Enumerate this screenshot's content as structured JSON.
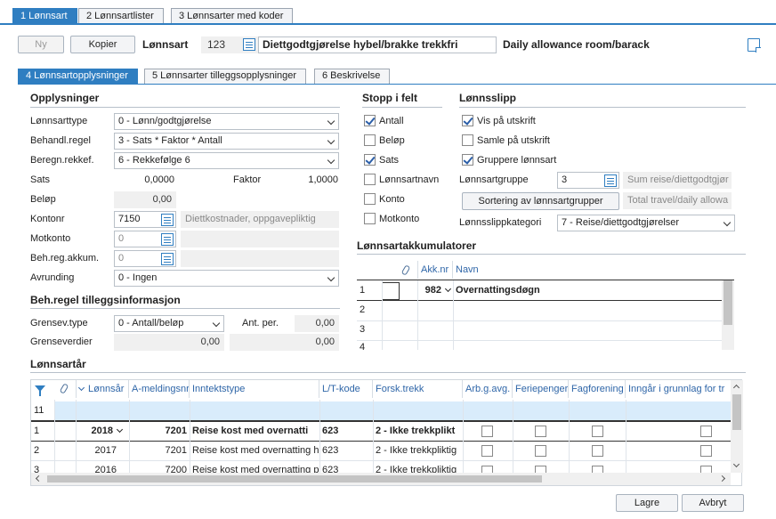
{
  "tabs": [
    {
      "label": "1 Lønnsart",
      "active": true
    },
    {
      "label": "2 Lønnsartlister",
      "active": false
    },
    {
      "label": "3 Lønnsarter med koder",
      "active": false
    }
  ],
  "toolbar": {
    "new_label": "Ny",
    "copy_label": "Kopier",
    "field_label": "Lønnsart",
    "wage_code": "123",
    "description": "Diettgodtgjørelse hybel/brakke trekkfri",
    "english": "Daily allowance room/barack"
  },
  "subtabs": [
    {
      "label": "4 Lønnsartopplysninger",
      "active": true
    },
    {
      "label": "5 Lønnsarter tilleggsopplysninger",
      "active": false
    },
    {
      "label": "6 Beskrivelse",
      "active": false
    }
  ],
  "opplysninger": {
    "title": "Opplysninger",
    "lonnsarttype_label": "Lønnsarttype",
    "lonnsarttype_value": "0 - Lønn/godtgjørelse",
    "behandl_label": "Behandl.regel",
    "behandl_value": "3 - Sats * Faktor * Antall",
    "beregn_label": "Beregn.rekkef.",
    "beregn_value": "6 - Rekkefølge 6",
    "sats_label": "Sats",
    "sats_value": "0,0000",
    "faktor_label": "Faktor",
    "faktor_value": "1,0000",
    "belop_label": "Beløp",
    "belop_value": "0,00",
    "kontonr_label": "Kontonr",
    "kontonr_value": "7150",
    "kontonr_desc": "Diettkostnader, oppgavepliktig",
    "motkonto_label": "Motkonto",
    "motkonto_value": "0",
    "behreg_label": "Beh.reg.akkum.",
    "behreg_value": "0",
    "avrunding_label": "Avrunding",
    "avrunding_value": "0 - Ingen"
  },
  "tillegg": {
    "title": "Beh.regel tilleggsinformasjon",
    "grensev_label": "Grensev.type",
    "grensev_value": "0 - Antall/beløp",
    "antper_label": "Ant. per.",
    "antper_value": "0,00",
    "grenseverdier_label": "Grenseverdier",
    "grenseverdier_value1": "0,00",
    "grenseverdier_value2": "0,00"
  },
  "stopp": {
    "title": "Stopp i felt",
    "items": [
      {
        "label": "Antall",
        "checked": true
      },
      {
        "label": "Beløp",
        "checked": false
      },
      {
        "label": "Sats",
        "checked": true
      },
      {
        "label": "Lønnsartnavn",
        "checked": false
      },
      {
        "label": "Konto",
        "checked": false
      },
      {
        "label": "Motkonto",
        "checked": false
      }
    ]
  },
  "lonnsslipp": {
    "title": "Lønnsslipp",
    "vis_label": "Vis på utskrift",
    "vis_checked": true,
    "samle_label": "Samle på utskrift",
    "samle_checked": false,
    "gruppere_label": "Gruppere lønnsart",
    "gruppere_checked": true,
    "gruppe_label": "Lønnsartgruppe",
    "gruppe_value": "3",
    "gruppe_desc": "Sum reise/diettgodtgjør",
    "sortering_label": "Sortering av lønnsartgrupper",
    "sortering_desc": "Total travel/daily allowa",
    "kategori_label": "Lønnsslippkategori",
    "kategori_value": "7 - Reise/diettgodtgjørelser"
  },
  "akkumulatorer": {
    "title": "Lønnsartakkumulatorer",
    "col_akknr": "Akk.nr",
    "col_navn": "Navn",
    "rows": [
      {
        "num": "1",
        "akknr": "982",
        "navn": "Overnattingsdøgn"
      },
      {
        "num": "2",
        "akknr": "",
        "navn": ""
      },
      {
        "num": "3",
        "akknr": "",
        "navn": ""
      },
      {
        "num": "4",
        "akknr": "",
        "navn": ""
      }
    ]
  },
  "lonnsartar": {
    "title": "Lønnsartår",
    "columns": [
      "Lønnsår",
      "A-meldingsnr",
      "Inntektstype",
      "L/T-kode",
      "Forsk.trekk",
      "Arb.g.avg.",
      "Feriepenger",
      "Fagforening",
      "Inngår i grunnlag for tr"
    ],
    "filter_row_num": "11",
    "rows": [
      {
        "num": "1",
        "ar": "2018",
        "amelding": "7201",
        "inntekt": "Reise kost med overnatti",
        "lt": "623",
        "forsk": "2 - Ikke trekkplikt",
        "bold": true
      },
      {
        "num": "2",
        "ar": "2017",
        "amelding": "7201",
        "inntekt": "Reise kost med overnatting h",
        "lt": "623",
        "forsk": "2 - Ikke trekkpliktig",
        "bold": false
      },
      {
        "num": "3",
        "ar": "2016",
        "amelding": "7200",
        "inntekt": "Reise kost med overnatting p",
        "lt": "623",
        "forsk": "2 - Ikke trekkpliktig",
        "bold": false
      }
    ]
  },
  "footer": {
    "save_label": "Lagre",
    "cancel_label": "Avbryt"
  },
  "colors": {
    "accent": "#2f7ec1",
    "header_text": "#2f66a8"
  }
}
